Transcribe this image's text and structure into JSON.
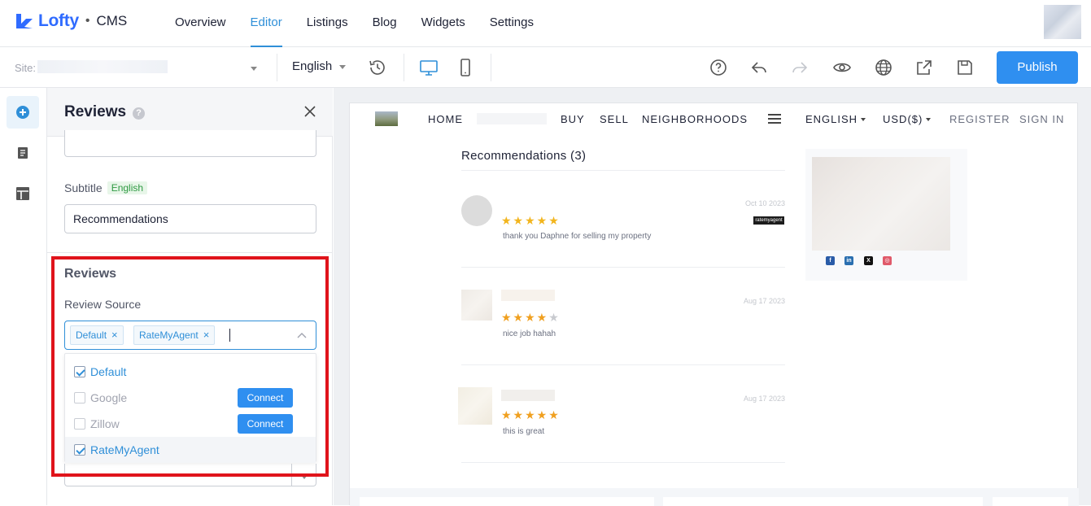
{
  "header": {
    "logo_text": "Lofty",
    "product": "CMS",
    "nav": [
      {
        "label": "Overview",
        "active": false
      },
      {
        "label": "Editor",
        "active": true
      },
      {
        "label": "Listings",
        "active": false
      },
      {
        "label": "Blog",
        "active": false
      },
      {
        "label": "Widgets",
        "active": false
      },
      {
        "label": "Settings",
        "active": false
      }
    ]
  },
  "toolbar": {
    "site_label": "Site:",
    "language": "English",
    "publish_label": "Publish",
    "icons": [
      "history-icon",
      "desktop-icon",
      "mobile-icon",
      "help-icon",
      "undo-icon",
      "redo-icon",
      "preview-eye-icon",
      "globe-icon",
      "share-icon",
      "save-icon"
    ]
  },
  "rail": {
    "icons": [
      "add-icon",
      "page-icon",
      "layout-icon"
    ]
  },
  "panel": {
    "title": "Reviews",
    "help": "?",
    "subtitle_label": "Subtitle",
    "subtitle_lang": "English",
    "subtitle_value": "Recommendations",
    "section_title": "Reviews",
    "source_label": "Review Source",
    "selected_chips": [
      {
        "label": "Default",
        "remove": "×"
      },
      {
        "label": "RateMyAgent",
        "remove": "×"
      }
    ],
    "options": [
      {
        "label": "Default",
        "checked": true,
        "connect": ""
      },
      {
        "label": "Google",
        "checked": false,
        "connect": "Connect"
      },
      {
        "label": "Zillow",
        "checked": false,
        "connect": "Connect"
      },
      {
        "label": "RateMyAgent",
        "checked": true,
        "connect": ""
      }
    ],
    "count_value": "3"
  },
  "preview": {
    "nav": [
      "HOME",
      "BUY",
      "SELL",
      "NEIGHBORHOODS"
    ],
    "nav_right": [
      "ENGLISH",
      "USD($)"
    ],
    "nav_auth": [
      "REGISTER",
      "SIGN IN"
    ],
    "reviews_title": "Recommendations (3)",
    "reviews": [
      {
        "date": "Oct 10 2023",
        "rating": 5,
        "text": "thank you Daphne for selling my property",
        "source_badge": "ratemyagent"
      },
      {
        "date": "Aug 17 2023",
        "rating": 4,
        "text": "nice job hahah",
        "source_badge": ""
      },
      {
        "date": "Aug 17 2023",
        "rating": 5,
        "text": "this is great",
        "source_badge": ""
      }
    ],
    "social_icons": [
      "facebook-icon",
      "linkedin-icon",
      "x-icon",
      "instagram-icon"
    ]
  },
  "colors": {
    "accent": "#2f8fd8",
    "publish": "#2f8ff0",
    "highlight": "#e0141b",
    "star": "#f0a020"
  }
}
